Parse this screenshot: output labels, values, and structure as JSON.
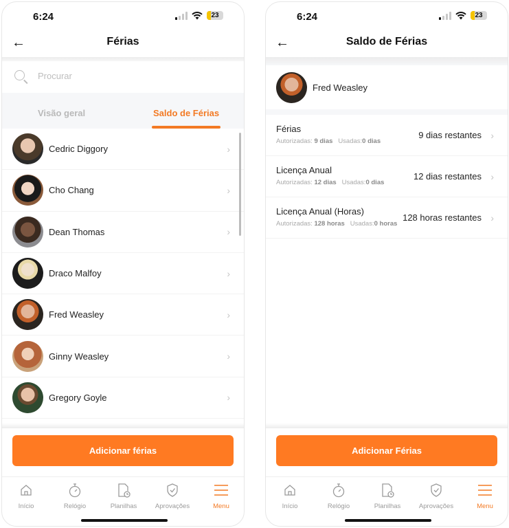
{
  "status_bar": {
    "time": "6:24",
    "battery": "23"
  },
  "left_screen": {
    "title": "Férias",
    "search": {
      "placeholder": "Procurar"
    },
    "tabs": [
      {
        "label": "Visão geral",
        "active": false
      },
      {
        "label": "Saldo de Férias",
        "active": true
      }
    ],
    "employees": [
      {
        "name": "Cedric Diggory"
      },
      {
        "name": "Cho Chang"
      },
      {
        "name": "Dean Thomas"
      },
      {
        "name": "Draco Malfoy"
      },
      {
        "name": "Fred Weasley"
      },
      {
        "name": "Ginny Weasley"
      },
      {
        "name": "Gregory Goyle"
      }
    ],
    "cta_label": "Adicionar férias"
  },
  "right_screen": {
    "title": "Saldo de Férias",
    "employee_name": "Fred Weasley",
    "balances": [
      {
        "title": "Férias",
        "authorized_label": "Autorizadas:",
        "authorized": "9 dias",
        "used_label": "Usadas:",
        "used": "0 dias",
        "remaining": "9 dias restantes"
      },
      {
        "title": "Licença Anual",
        "authorized_label": "Autorizadas:",
        "authorized": "12 dias",
        "used_label": "Usadas:",
        "used": "0 dias",
        "remaining": "12 dias restantes"
      },
      {
        "title": "Licença Anual (Horas)",
        "authorized_label": "Autorizadas:",
        "authorized": "128 horas",
        "used_label": "Usadas:",
        "used": "0 horas",
        "remaining": "128 horas restantes"
      }
    ],
    "cta_label": "Adicionar Férias"
  },
  "tabbar": {
    "items": [
      {
        "label": "Início",
        "icon": "home-icon"
      },
      {
        "label": "Relógio",
        "icon": "stopwatch-icon"
      },
      {
        "label": "Planilhas",
        "icon": "timesheet-icon"
      },
      {
        "label": "Aprovações",
        "icon": "shield-check-icon"
      },
      {
        "label": "Menu",
        "icon": "menu-icon",
        "active": true
      }
    ]
  },
  "colors": {
    "accent": "#f37a24",
    "cta": "#ff7a22"
  }
}
